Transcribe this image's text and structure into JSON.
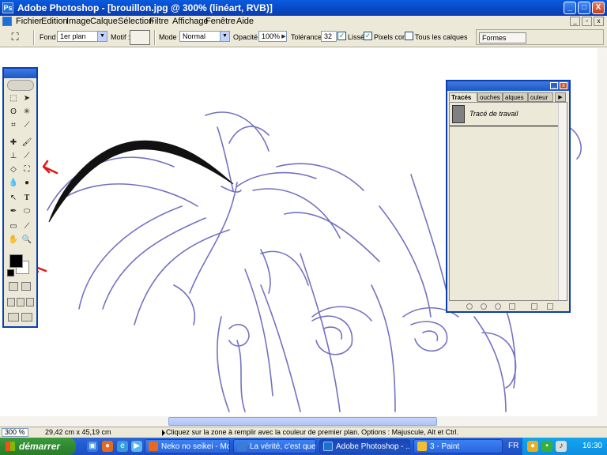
{
  "window": {
    "title": "Adobe Photoshop - [brouillon.jpg @ 300% (linéart, RVB)]",
    "minimize": "_",
    "maximize": "□",
    "close": "X"
  },
  "menu": {
    "items": [
      "Fichier",
      "Edition",
      "Image",
      "Calque",
      "Sélection",
      "Filtre",
      "Affichage",
      "Fenêtre",
      "Aide"
    ]
  },
  "options": {
    "fond_label": "Fond :",
    "fond_value": "1er plan",
    "motif_label": "Motif :",
    "mode_label": "Mode :",
    "mode_value": "Normal",
    "opacite_label": "Opacité :",
    "opacite_value": "100%",
    "tolerance_label": "Tolérance :",
    "tolerance_value": "32",
    "lisse_label": "Lissé",
    "lisse_checked": true,
    "pixels_label": "Pixels cont.",
    "pixels_checked": true,
    "tous_label": "Tous les calques",
    "tous_checked": false,
    "formes_tab": "Formes"
  },
  "toolbox": {
    "foreground_color": "#000000",
    "background_color": "#ffffff",
    "text_tool": "T"
  },
  "paths_palette": {
    "tabs": [
      "Tracés",
      "ouches",
      "alques",
      "ouleur"
    ],
    "active_tab": "Tracés",
    "rows": [
      {
        "label": "Tracé de travail"
      }
    ]
  },
  "status": {
    "zoom": "300 %",
    "size": "29,42 cm x 45,19 cm",
    "hint": "Cliquez sur la zone à remplir avec la couleur de premier plan. Options : Majuscule, Alt et Ctrl."
  },
  "taskbar": {
    "start_label": "démarrer",
    "tasks": [
      {
        "label": "Neko no seikei - Moz...",
        "active": false,
        "color": "#e8681c"
      },
      {
        "label": "La vérité, c'est que ...",
        "active": false,
        "color": "#3a7bd5"
      },
      {
        "label": "Adobe Photoshop - ...",
        "active": true,
        "color": "#1c6fd6"
      },
      {
        "label": "3 - Paint",
        "active": false,
        "color": "#f0c030"
      }
    ],
    "language": "FR",
    "clock": "16:30"
  }
}
